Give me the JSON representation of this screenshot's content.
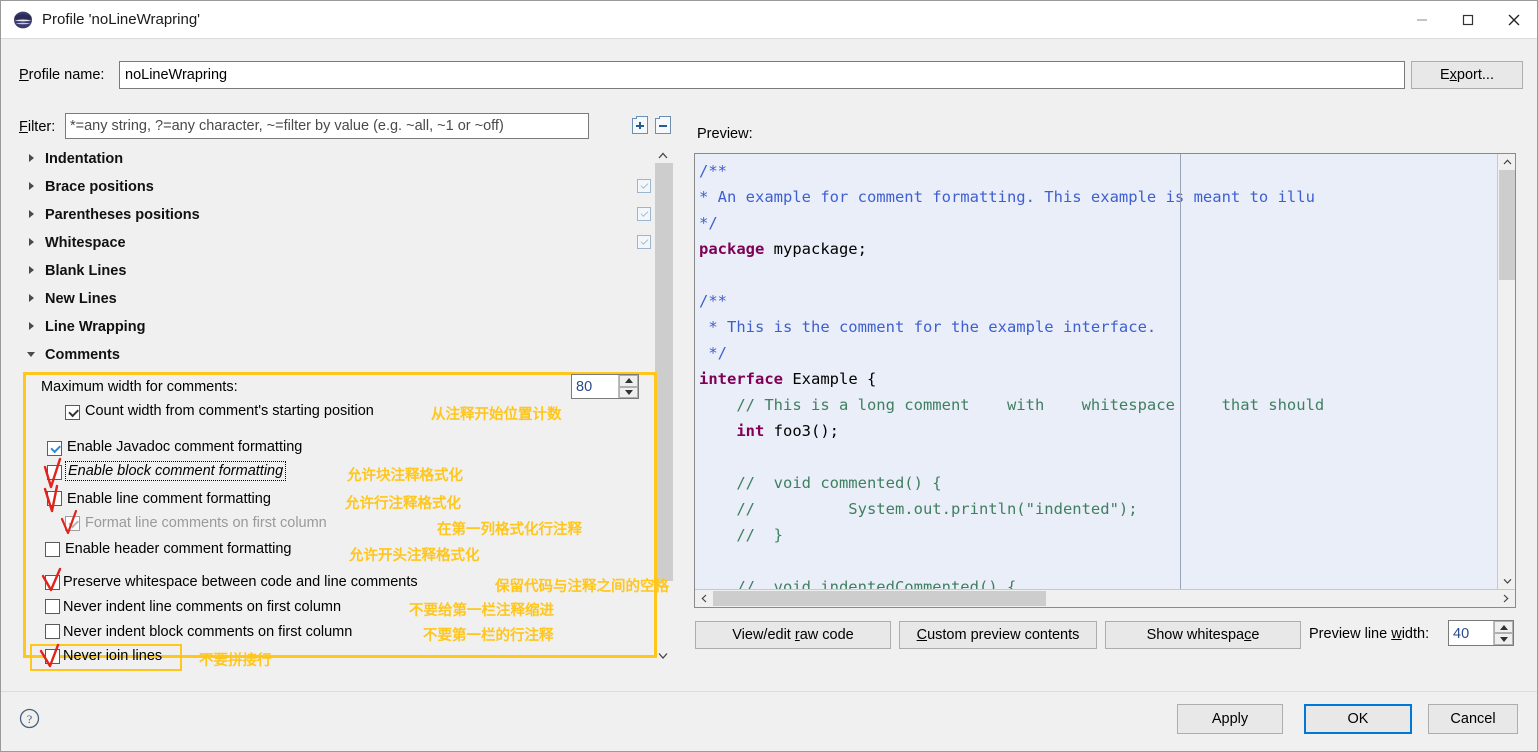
{
  "window": {
    "title": "Profile 'noLineWrapring'",
    "icon": "eclipse-icon",
    "minimize": "—",
    "maximize": "☐",
    "close": "✕"
  },
  "profile": {
    "label": "Profile name:",
    "label_mnemonic": "P",
    "value": "noLineWrapring",
    "export_label": "Export..."
  },
  "filter": {
    "label": "Filter:",
    "placeholder": "*=any string, ?=any character, ~=filter by value (e.g. ~all, ~1 or ~off)",
    "value": "",
    "expand_all": "expand-all-icon",
    "collapse_all": "collapse-all-icon"
  },
  "tree": {
    "items": [
      {
        "label": "Indentation",
        "expanded": false,
        "checkbox": false
      },
      {
        "label": "Brace positions",
        "expanded": false,
        "checkbox": true
      },
      {
        "label": "Parentheses positions",
        "expanded": false,
        "checkbox": true
      },
      {
        "label": "Whitespace",
        "expanded": false,
        "checkbox": true
      },
      {
        "label": "Blank Lines",
        "expanded": false,
        "checkbox": false
      },
      {
        "label": "New Lines",
        "expanded": false,
        "checkbox": false
      },
      {
        "label": "Line Wrapping",
        "expanded": false,
        "checkbox": false
      },
      {
        "label": "Comments",
        "expanded": true,
        "checkbox": false
      }
    ],
    "scroll_up": "∧",
    "scroll_down": "∨"
  },
  "comments": {
    "max_width_label": "Maximum width for comments:",
    "max_width_value": "80",
    "options": [
      {
        "label": "Count width from comment's starting position",
        "state": "checked-dark",
        "annotation": "从注释开始位置计数"
      },
      {
        "label": "Enable Javadoc comment formatting",
        "state": "checked-blue",
        "annotation": ""
      },
      {
        "label": "Enable block comment formatting",
        "state": "unchecked-red",
        "annotation": "允许块注释格式化"
      },
      {
        "label": "Enable line comment formatting",
        "state": "unchecked-red",
        "annotation": "允许行注释格式化"
      },
      {
        "label": "Format line comments on first column",
        "state": "disabled-red",
        "annotation": "在第一列格式化行注释"
      },
      {
        "label": "Enable header comment formatting",
        "state": "unchecked",
        "annotation": "允许开头注释格式化"
      },
      {
        "label": "Preserve whitespace between code and line comments",
        "state": "unchecked-red",
        "annotation": "保留代码与注释之间的空格"
      },
      {
        "label": "Never indent line comments on first column",
        "state": "unchecked",
        "annotation": "不要给第一栏注释缩进"
      },
      {
        "label": "Never indent block comments on first column",
        "state": "unchecked",
        "annotation": "不要第一栏的行注释"
      },
      {
        "label": "Never ioin lines",
        "state": "unchecked-red",
        "annotation": "不要拼接行"
      }
    ]
  },
  "preview": {
    "label": "Preview:",
    "code_lines": [
      [
        {
          "t": "/**",
          "c": "jdoc"
        }
      ],
      [
        {
          "t": "* An example for comment formatting. This example is meant to illu",
          "c": "jdoc"
        }
      ],
      [
        {
          "t": "*/",
          "c": "jdoc"
        }
      ],
      [
        {
          "t": "package ",
          "c": "kw"
        },
        {
          "t": "mypackage;",
          "c": "plain"
        }
      ],
      [
        {
          "t": "",
          "c": "plain"
        }
      ],
      [
        {
          "t": "/**",
          "c": "jdoc"
        }
      ],
      [
        {
          "t": " * This is the comment for the example interface.",
          "c": "jdoc"
        }
      ],
      [
        {
          "t": " */",
          "c": "jdoc"
        }
      ],
      [
        {
          "t": "interface ",
          "c": "kw"
        },
        {
          "t": "Example {",
          "c": "plain"
        }
      ],
      [
        {
          "t": "    // This is a long comment    with    whitespace     that should",
          "c": "cmt"
        }
      ],
      [
        {
          "t": "    int ",
          "c": "kw"
        },
        {
          "t": "foo3();",
          "c": "plain"
        }
      ],
      [
        {
          "t": "",
          "c": "plain"
        }
      ],
      [
        {
          "t": "    //  void commented() {",
          "c": "cmt"
        }
      ],
      [
        {
          "t": "    //          System.out.println(\"indented\");",
          "c": "cmt"
        }
      ],
      [
        {
          "t": "    //  }",
          "c": "cmt"
        }
      ],
      [
        {
          "t": "",
          "c": "plain"
        }
      ],
      [
        {
          "t": "    //  void indentedCommented() {",
          "c": "cmt"
        }
      ]
    ],
    "toolbar": {
      "raw_code": "View/edit raw code",
      "custom_contents": "Custom preview contents",
      "show_whitespace": "Show whitespace",
      "line_width_label": "Preview line width:",
      "line_width_value": "40"
    }
  },
  "footer": {
    "help": "help-icon",
    "apply": "Apply",
    "ok": "OK",
    "cancel": "Cancel"
  },
  "colors": {
    "annotation": "#FFC61E",
    "highlight_box": "#FFC61E",
    "red_mark": "#E0241B",
    "accent": "#0078D7",
    "preview_bg": "#E9EEF9"
  }
}
